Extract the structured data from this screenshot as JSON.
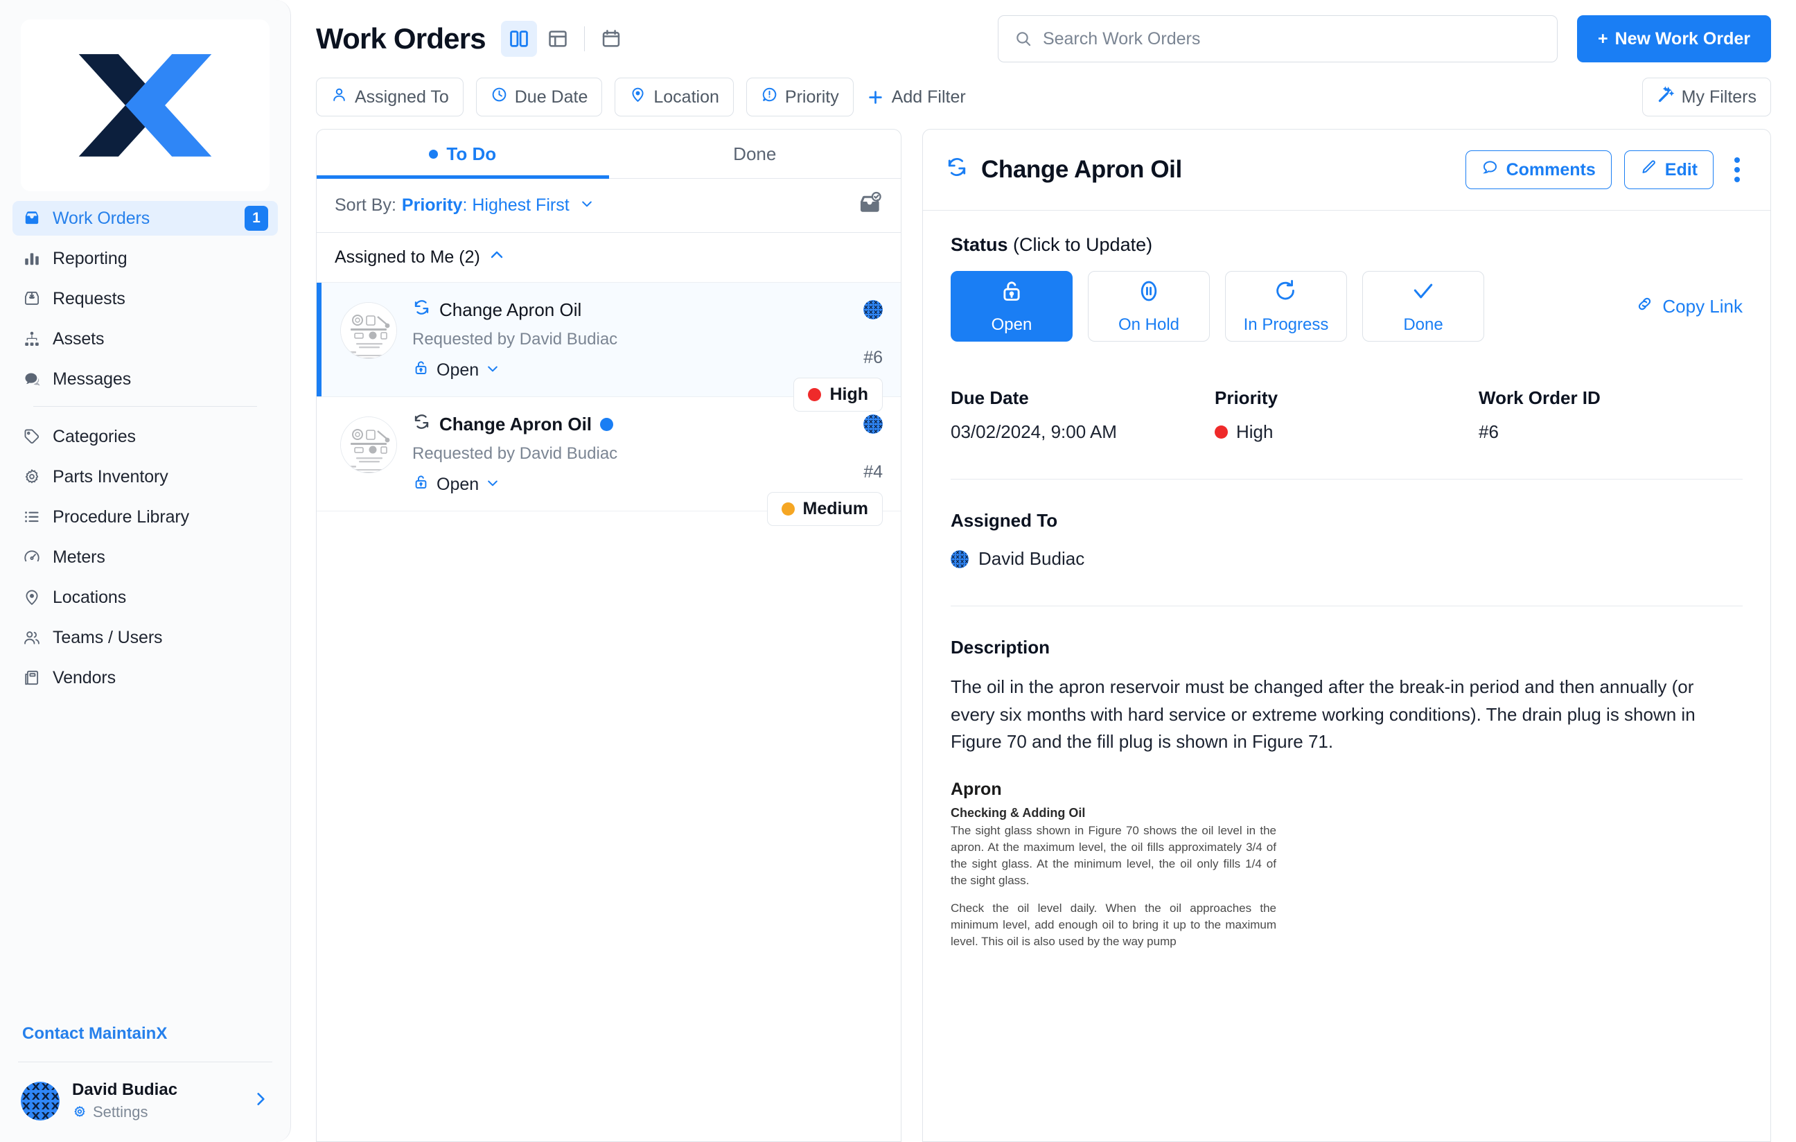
{
  "sidebar": {
    "logo": {
      "name": "maintainx-logo",
      "dark": "#0c1f3d",
      "blue": "#2f86f6"
    },
    "primary_items": [
      {
        "label": "Work Orders",
        "icon": "inbox-icon",
        "badge": "1",
        "active": true
      },
      {
        "label": "Reporting",
        "icon": "bar-chart-icon",
        "badge": "",
        "active": false
      },
      {
        "label": "Requests",
        "icon": "inbox-download-icon",
        "badge": "",
        "active": false
      },
      {
        "label": "Assets",
        "icon": "sitemap-icon",
        "badge": "",
        "active": false
      },
      {
        "label": "Messages",
        "icon": "chat-bubble-icon",
        "badge": "",
        "active": false
      }
    ],
    "secondary_items": [
      {
        "label": "Categories",
        "icon": "tag-icon"
      },
      {
        "label": "Parts Inventory",
        "icon": "gear-icon"
      },
      {
        "label": "Procedure Library",
        "icon": "list-icon"
      },
      {
        "label": "Meters",
        "icon": "gauge-icon"
      },
      {
        "label": "Locations",
        "icon": "map-pin-icon"
      },
      {
        "label": "Teams / Users",
        "icon": "users-icon"
      },
      {
        "label": "Vendors",
        "icon": "building-icon"
      }
    ],
    "contact_link": "Contact MaintainX",
    "profile": {
      "name": "David Budiac",
      "settings_label": "Settings"
    }
  },
  "header": {
    "title": "Work Orders",
    "views": [
      {
        "name": "split-view-icon",
        "label": "Split View",
        "active": true
      },
      {
        "name": "table-view-icon",
        "label": "Table View",
        "active": false
      },
      {
        "name": "calendar-view-icon",
        "label": "Calendar View",
        "active": false
      }
    ],
    "search_placeholder": "Search Work Orders",
    "search_value": "",
    "new_button": "New Work Order",
    "new_button_plus": "+"
  },
  "filters": {
    "chips": [
      {
        "label": "Assigned To",
        "icon": "person-icon"
      },
      {
        "label": "Due Date",
        "icon": "clock-icon"
      },
      {
        "label": "Location",
        "icon": "map-pin-icon"
      },
      {
        "label": "Priority",
        "icon": "alert-circle-icon"
      }
    ],
    "add_filter": "Add Filter",
    "my_filters": "My Filters"
  },
  "list": {
    "tabs": [
      {
        "label": "To Do",
        "active": true,
        "dot": true
      },
      {
        "label": "Done",
        "active": false,
        "dot": false
      }
    ],
    "sort_prefix": "Sort By:",
    "sort_field": "Priority",
    "sort_direction": ": Highest First",
    "group_header": "Assigned to Me (2)",
    "items": [
      {
        "title": "Change Apron Oil",
        "requested_by": "Requested by David Budiac",
        "status": "Open",
        "id": "#6",
        "priority": "High",
        "priority_color": "#ef2a2a",
        "selected": true,
        "unread": false
      },
      {
        "title": "Change Apron Oil",
        "requested_by": "Requested by David Budiac",
        "status": "Open",
        "id": "#4",
        "priority": "Medium",
        "priority_color": "#f5a623",
        "selected": false,
        "unread": true
      }
    ]
  },
  "detail": {
    "title": "Change Apron Oil",
    "comments_label": "Comments",
    "edit_label": "Edit",
    "status_label_bold": "Status",
    "status_label_rest": " (Click to Update)",
    "statuses": [
      {
        "label": "Open",
        "icon": "unlock-icon",
        "active": true
      },
      {
        "label": "On Hold",
        "icon": "pause-circle-icon",
        "active": false
      },
      {
        "label": "In Progress",
        "icon": "refresh-icon",
        "active": false
      },
      {
        "label": "Done",
        "icon": "check-icon",
        "active": false
      }
    ],
    "copy_link": "Copy Link",
    "meta": [
      {
        "heading": "Due Date",
        "value": "03/02/2024, 9:00 AM",
        "dot": ""
      },
      {
        "heading": "Priority",
        "value": "High",
        "dot": "#ef2a2a"
      },
      {
        "heading": "Work Order ID",
        "value": "#6",
        "dot": ""
      }
    ],
    "assigned_heading": "Assigned To",
    "assigned_name": "David Budiac",
    "description_heading": "Description",
    "description_text": "The oil in the apron reservoir must be changed after the break-in period and then annually (or every six months with hard service or extreme working conditions). The drain plug is shown in Figure 70 and the fill plug is shown in Figure 71.",
    "attachment": {
      "title": "Apron",
      "subtitle": "Checking & Adding Oil",
      "para1": "The sight glass shown in Figure 70 shows the oil level in the apron. At the maximum level, the oil fills approximately 3/4 of the sight glass. At the minimum level, the oil only fills 1/4 of the sight glass.",
      "para2": "Check the oil level daily. When the oil approaches the minimum level, add enough oil to bring it up to the maximum level. This oil is also used by the way pump"
    }
  },
  "colors": {
    "accent": "#1a7ef4",
    "high": "#ef2a2a",
    "medium": "#f5a623",
    "text": "#10151f",
    "muted": "#7b8593"
  }
}
